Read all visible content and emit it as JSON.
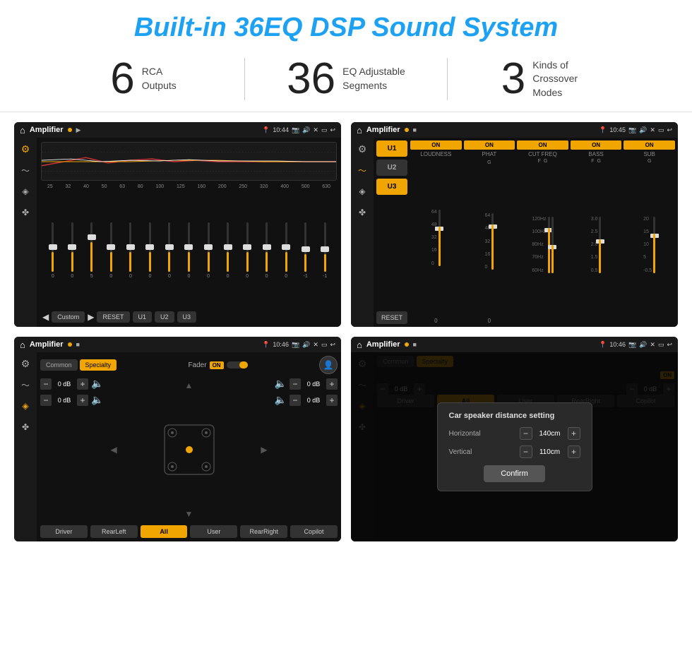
{
  "page": {
    "title": "Built-in 36EQ DSP Sound System"
  },
  "stats": [
    {
      "number": "6",
      "label": "RCA\nOutputs"
    },
    {
      "number": "36",
      "label": "EQ Adjustable\nSegments"
    },
    {
      "number": "3",
      "label": "Kinds of\nCrossover Modes"
    }
  ],
  "screens": [
    {
      "id": "eq",
      "time": "10:44",
      "title": "Amplifier",
      "type": "eq"
    },
    {
      "id": "crossover",
      "time": "10:45",
      "title": "Amplifier",
      "type": "crossover"
    },
    {
      "id": "fader",
      "time": "10:46",
      "title": "Amplifier",
      "type": "fader"
    },
    {
      "id": "dialog",
      "time": "10:46",
      "title": "Amplifier",
      "type": "dialog"
    }
  ],
  "eq": {
    "bands": [
      "25",
      "32",
      "40",
      "50",
      "63",
      "80",
      "100",
      "125",
      "160",
      "200",
      "250",
      "320",
      "400",
      "500",
      "630"
    ],
    "values": [
      "0",
      "0",
      "5",
      "0",
      "0",
      "0",
      "0",
      "0",
      "0",
      "0",
      "0",
      "0",
      "0",
      "-1",
      "-1"
    ],
    "presets": [
      "Custom",
      "RESET",
      "U1",
      "U2",
      "U3"
    ]
  },
  "crossover": {
    "users": [
      "U1",
      "U2",
      "U3"
    ],
    "channels": [
      "LOUDNESS",
      "PHAT",
      "CUT FREQ",
      "BASS",
      "SUB"
    ]
  },
  "fader": {
    "tabs": [
      "Common",
      "Specialty"
    ],
    "fader_label": "Fader",
    "on_label": "ON",
    "zones": [
      "Driver",
      "RearLeft",
      "All",
      "User",
      "RearRight",
      "Copilot"
    ],
    "vol_rows": [
      "0 dB",
      "0 dB",
      "0 dB",
      "0 dB"
    ]
  },
  "dialog": {
    "title": "Car speaker distance setting",
    "fields": [
      {
        "label": "Horizontal",
        "value": "140cm"
      },
      {
        "label": "Vertical",
        "value": "110cm"
      }
    ],
    "confirm_label": "Confirm"
  },
  "icons": {
    "home": "⌂",
    "back": "↩",
    "settings": "⚙",
    "eq_icon": "≡",
    "wave": "∿",
    "speaker": "◈",
    "crosshair": "⊕"
  }
}
